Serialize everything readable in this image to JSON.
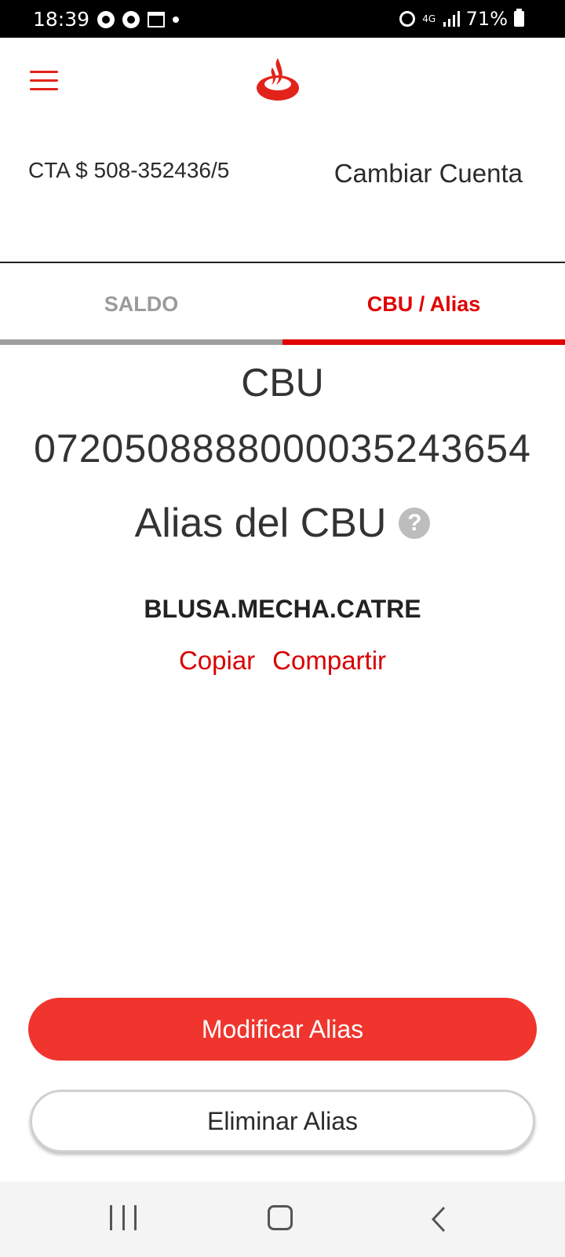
{
  "status_bar": {
    "time": "18:39",
    "battery": "71%",
    "network": "4G",
    "left_icons": [
      "location-app-icon",
      "chrome-icon",
      "calendar-icon",
      "dot-icon"
    ],
    "right_icons": [
      "alarm-icon",
      "4g-icon",
      "signal-icon",
      "battery-icon"
    ]
  },
  "header": {
    "menu_icon": "hamburger-menu-icon",
    "logo_icon": "santander-flame-logo"
  },
  "account": {
    "label": "CTA $ 508-352436/5",
    "change_label": "Cambiar Cuenta"
  },
  "tabs": [
    {
      "label": "SALDO",
      "active": false
    },
    {
      "label": "CBU / Alias",
      "active": true
    }
  ],
  "cbu": {
    "title": "CBU",
    "number": "0720508888000035243654",
    "alias_title": "Alias del CBU",
    "help_icon_text": "?",
    "alias_value": "BLUSA.MECHA.CATRE",
    "copy_label": "Copiar",
    "share_label": "Compartir"
  },
  "buttons": {
    "modify_label": "Modificar Alias",
    "delete_label": "Eliminar Alias"
  },
  "colors": {
    "brand_red": "#e00000",
    "primary_button": "#ef352d",
    "inactive_tab": "#9b9b9b"
  }
}
